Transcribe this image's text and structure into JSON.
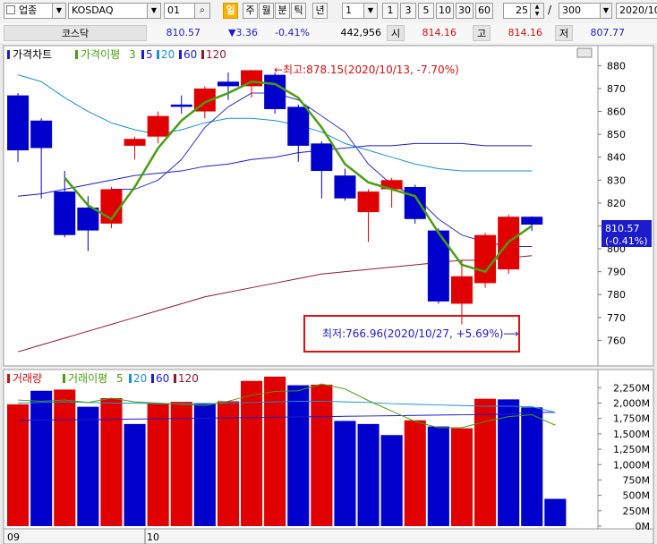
{
  "toolbar": {
    "market_type": "업종",
    "market": "KOSDAQ",
    "code": "01",
    "periods": [
      "일",
      "주",
      "월",
      "분",
      "틱",
      "년"
    ],
    "period_active": "일",
    "interval_value": "1",
    "intervals": [
      "1",
      "3",
      "5",
      "10",
      "30",
      "60"
    ],
    "count": "25",
    "separator": "/",
    "total": "300",
    "date": "2020/10"
  },
  "quote": {
    "name": "코스닥",
    "price": "810.57",
    "change": "▼3.36",
    "change_pct": "-0.41%",
    "volume": "442,956",
    "open_label": "시",
    "open": "814.16",
    "high_label": "고",
    "high": "814.16",
    "low_label": "저",
    "low": "807.77"
  },
  "price_legend": {
    "main": "가격차트",
    "ma_label": "가격이평",
    "ma_periods": [
      "3",
      "5",
      "20",
      "60",
      "120"
    ],
    "colors": {
      "3": "#4a9d10",
      "5": "#1c1ccc",
      "20": "#1b8fd0",
      "60": "#1c1ccc",
      "120": "#8a1a2e"
    }
  },
  "volume_legend": {
    "main": "거래량",
    "ma_label": "거래이평",
    "ma_periods": [
      "5",
      "20",
      "60",
      "120"
    ]
  },
  "annotations": {
    "high": "←최고:878.15(2020/10/13, -7.70%)",
    "low": "최저:766.96(2020/10/27, +5.69%)⟶"
  },
  "current_price_tag": {
    "price": "810.57",
    "pct": "(-0.41%)"
  },
  "x_labels": [
    "09",
    "10"
  ],
  "chart_data": {
    "type": "candlestick",
    "price_axis": {
      "ticks": [
        880,
        870,
        860,
        850,
        840,
        830,
        820,
        810,
        800,
        790,
        780,
        770,
        760
      ],
      "range": [
        750,
        886
      ]
    },
    "volume_axis": {
      "ticks": [
        "2,250M",
        "2,000M",
        "1,750M",
        "1,500M",
        "1,250M",
        "1,000M",
        "750M",
        "500M",
        "250M",
        "0M"
      ],
      "max_millions": 2400
    },
    "candles": [
      {
        "o": 867,
        "h": 868,
        "l": 838,
        "c": 843
      },
      {
        "o": 856,
        "h": 857,
        "l": 822,
        "c": 844
      },
      {
        "o": 825,
        "h": 834,
        "l": 805,
        "c": 806
      },
      {
        "o": 818,
        "h": 823,
        "l": 799,
        "c": 808
      },
      {
        "o": 811,
        "h": 827,
        "l": 809,
        "c": 826
      },
      {
        "o": 845,
        "h": 849,
        "l": 839,
        "c": 848
      },
      {
        "o": 849,
        "h": 860,
        "l": 846,
        "c": 858
      },
      {
        "o": 863,
        "h": 867,
        "l": 859,
        "c": 862
      },
      {
        "o": 860,
        "h": 871,
        "l": 857,
        "c": 870
      },
      {
        "o": 873,
        "h": 877,
        "l": 865,
        "c": 871
      },
      {
        "o": 871,
        "h": 878.15,
        "l": 866,
        "c": 878
      },
      {
        "o": 876,
        "h": 877,
        "l": 859,
        "c": 861
      },
      {
        "o": 862,
        "h": 863,
        "l": 838,
        "c": 845
      },
      {
        "o": 846,
        "h": 847,
        "l": 822,
        "c": 834
      },
      {
        "o": 832,
        "h": 835,
        "l": 821,
        "c": 822
      },
      {
        "o": 816,
        "h": 826,
        "l": 803,
        "c": 825
      },
      {
        "o": 826,
        "h": 831,
        "l": 818,
        "c": 830
      },
      {
        "o": 827,
        "h": 828,
        "l": 811,
        "c": 813
      },
      {
        "o": 808,
        "h": 809,
        "l": 776,
        "c": 777
      },
      {
        "o": 776,
        "h": 795,
        "l": 766.96,
        "c": 788
      },
      {
        "o": 785,
        "h": 807,
        "l": 783,
        "c": 806
      },
      {
        "o": 791,
        "h": 815,
        "l": 789,
        "c": 814
      },
      {
        "o": 814,
        "h": 814.16,
        "l": 807.77,
        "c": 810.57
      }
    ],
    "volume_millions": [
      1980,
      2200,
      2220,
      1940,
      2080,
      1660,
      1990,
      2020,
      2000,
      2030,
      2360,
      2430,
      2290,
      2300,
      1710,
      1660,
      1480,
      1720,
      1620,
      1590,
      2070,
      2060,
      1930,
      442.956
    ],
    "volume_colors": [
      "red",
      "blue",
      "red",
      "blue",
      "red",
      "blue",
      "red",
      "red",
      "blue",
      "red",
      "red",
      "red",
      "blue",
      "red",
      "blue",
      "blue",
      "blue",
      "red",
      "blue",
      "red",
      "red",
      "blue",
      "blue",
      "blue"
    ],
    "ma3": [
      null,
      null,
      831,
      819,
      813,
      827,
      844,
      856,
      864,
      868,
      873,
      872,
      866,
      853,
      837,
      829,
      826,
      823,
      807,
      793,
      790,
      803,
      810
    ],
    "ma5": [
      null,
      null,
      null,
      null,
      826,
      826,
      830,
      839,
      853,
      862,
      868,
      868,
      865,
      858,
      851,
      837,
      828,
      823,
      813,
      806,
      803,
      801,
      801
    ],
    "ma20": [
      876,
      873,
      866,
      860,
      855,
      852,
      850,
      852,
      855,
      857,
      857,
      856,
      854,
      851,
      846,
      843,
      840,
      837,
      835,
      834,
      834,
      834,
      834
    ],
    "ma60": [
      823,
      824,
      826,
      828,
      830,
      832,
      833,
      834,
      836,
      837,
      839,
      840,
      842,
      843,
      844,
      845,
      845,
      846,
      846,
      846,
      845,
      845,
      845
    ],
    "ma120": [
      755,
      758,
      761,
      764,
      767,
      770,
      773,
      776,
      779,
      781,
      783,
      785,
      787,
      789,
      790,
      791,
      792,
      793,
      794,
      795,
      795,
      796,
      797
    ],
    "vol_ma5": [
      2050,
      2030,
      2050,
      2010,
      2080,
      2020,
      2000,
      1980,
      1960,
      2030,
      2130,
      2190,
      2200,
      2310,
      2230,
      2040,
      1870,
      1700,
      1600,
      1600,
      1700,
      1780,
      1810,
      1640
    ],
    "vol_ma20": [
      2000,
      2010,
      2020,
      2010,
      2000,
      2000,
      1990,
      1990,
      1990,
      2000,
      2010,
      2020,
      2030,
      2030,
      2020,
      2010,
      1990,
      1980,
      1970,
      1960,
      1950,
      1950,
      1940,
      1850
    ],
    "vol_ma60": [
      1720,
      1725,
      1730,
      1730,
      1735,
      1740,
      1745,
      1750,
      1755,
      1760,
      1765,
      1770,
      1775,
      1780,
      1785,
      1790,
      1795,
      1800,
      1805,
      1810,
      1815,
      1820,
      1850,
      1850
    ]
  }
}
